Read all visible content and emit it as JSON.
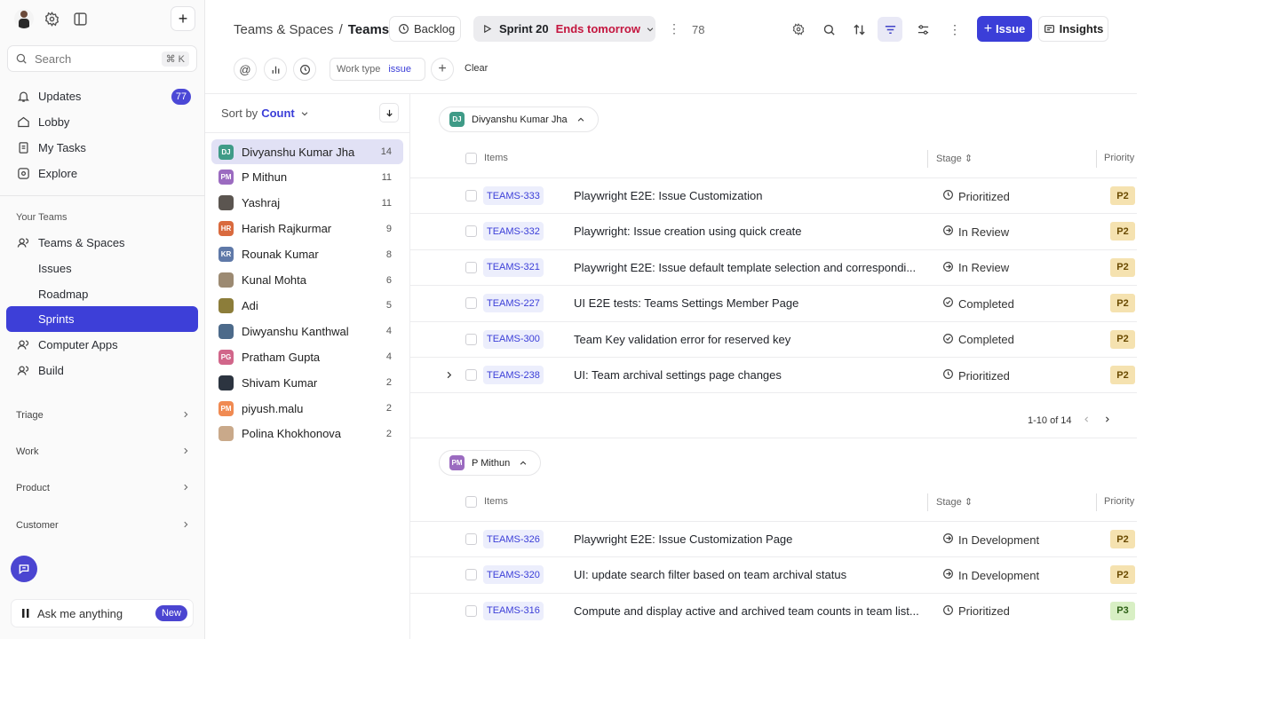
{
  "sidebar": {
    "search_placeholder": "Search",
    "search_shortcut": "⌘ K",
    "nav": [
      {
        "label": "Updates",
        "badge": "77"
      },
      {
        "label": "Lobby"
      },
      {
        "label": "My Tasks"
      },
      {
        "label": "Explore"
      }
    ],
    "your_teams_label": "Your Teams",
    "teams": [
      {
        "label": "Teams & Spaces"
      },
      {
        "label": "Issues"
      },
      {
        "label": "Roadmap"
      },
      {
        "label": "Sprints",
        "active": true
      },
      {
        "label": "Computer Apps"
      },
      {
        "label": "Build"
      }
    ],
    "sections": [
      "Triage",
      "Work",
      "Product",
      "Customer"
    ],
    "ask_placeholder": "Ask me anything",
    "ask_badge": "New"
  },
  "header": {
    "crumb_parent": "Teams & Spaces",
    "crumb_sep": "/",
    "crumb_current": "Teams",
    "backlog_label": "Backlog",
    "sprint_name": "Sprint 20",
    "sprint_status": "Ends tomorrow",
    "item_count": "78",
    "issue_button": "Issue",
    "insights_button": "Insights"
  },
  "filters": {
    "work_type_label": "Work type",
    "work_type_value": "issue",
    "clear_label": "Clear"
  },
  "owners_panel": {
    "sort_label": "Sort by",
    "sort_value": "Count",
    "owners": [
      {
        "name": "Divyanshu Kumar Jha",
        "initials": "DJ",
        "count": "14",
        "color": "#3f9b87",
        "selected": true
      },
      {
        "name": "P Mithun",
        "initials": "PM",
        "count": "11",
        "color": "#9b6bc0"
      },
      {
        "name": "Yashraj",
        "initials": "",
        "count": "11",
        "color": "#5b5550"
      },
      {
        "name": "Harish Rajkurmar",
        "initials": "HR",
        "count": "9",
        "color": "#d96a3e"
      },
      {
        "name": "Rounak Kumar",
        "initials": "KR",
        "count": "8",
        "color": "#5f79a8"
      },
      {
        "name": "Kunal Mohta",
        "initials": "",
        "count": "6",
        "color": "#9c8a72"
      },
      {
        "name": "Adi",
        "initials": "",
        "count": "5",
        "color": "#8c7d3a"
      },
      {
        "name": "Diwyanshu Kanthwal",
        "initials": "",
        "count": "4",
        "color": "#4c6a8a"
      },
      {
        "name": "Pratham Gupta",
        "initials": "PG",
        "count": "4",
        "color": "#d1668a"
      },
      {
        "name": "Shivam Kumar",
        "initials": "",
        "count": "2",
        "color": "#2c3440"
      },
      {
        "name": "piyush.malu",
        "initials": "PM",
        "count": "2",
        "color": "#f08a52"
      },
      {
        "name": "Polina Khokhonova",
        "initials": "",
        "count": "2",
        "color": "#c9a98a"
      }
    ]
  },
  "columns": {
    "items": "Items",
    "stage": "Stage",
    "priority": "Priority"
  },
  "groups": [
    {
      "owner": "Divyanshu Kumar Jha",
      "initials": "DJ",
      "color": "#3f9b87",
      "pagination": "1-10 of 14",
      "rows": [
        {
          "key": "TEAMS-333",
          "title": "Playwright E2E: Issue Customization",
          "stage": "Prioritized",
          "stage_icon": "clock",
          "priority": "P2"
        },
        {
          "key": "TEAMS-332",
          "title": "Playwright: Issue creation using quick create",
          "stage": "In Review",
          "stage_icon": "arrow",
          "priority": "P2"
        },
        {
          "key": "TEAMS-321",
          "title": "Playwright E2E: Issue default template selection and correspondi...",
          "stage": "In Review",
          "stage_icon": "arrow",
          "priority": "P2"
        },
        {
          "key": "TEAMS-227",
          "title": "UI E2E tests: Teams Settings Member Page",
          "stage": "Completed",
          "stage_icon": "check",
          "priority": "P2"
        },
        {
          "key": "TEAMS-300",
          "title": "Team Key validation error for reserved key",
          "stage": "Completed",
          "stage_icon": "check",
          "priority": "P2"
        },
        {
          "key": "TEAMS-238",
          "title": "UI: Team archival settings page changes",
          "stage": "Prioritized",
          "stage_icon": "clock",
          "priority": "P2",
          "expandable": true
        }
      ]
    },
    {
      "owner": "P Mithun",
      "initials": "PM",
      "color": "#9b6bc0",
      "rows": [
        {
          "key": "TEAMS-326",
          "title": "Playwright E2E: Issue Customization Page",
          "stage": "In Development",
          "stage_icon": "arrow",
          "priority": "P2"
        },
        {
          "key": "TEAMS-320",
          "title": "UI: update search filter based on team archival status",
          "stage": "In Development",
          "stage_icon": "arrow",
          "priority": "P2"
        },
        {
          "key": "TEAMS-316",
          "title": "Compute and display active and archived team counts in team list...",
          "stage": "Prioritized",
          "stage_icon": "clock",
          "priority": "P3"
        }
      ]
    }
  ]
}
